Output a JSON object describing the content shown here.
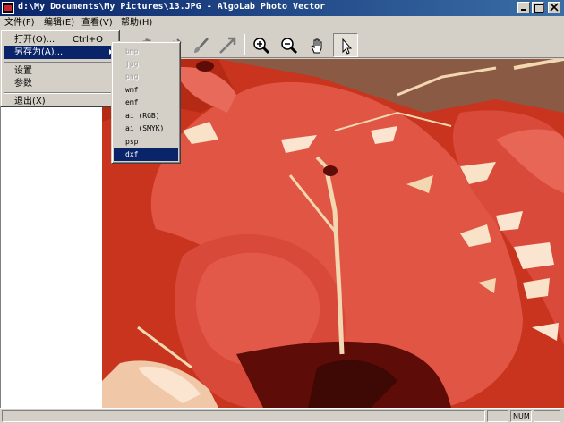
{
  "window": {
    "title": "d:\\My Documents\\My Pictures\\13.JPG - AlgoLab Photo Vector",
    "controls": [
      "minimize",
      "maximize",
      "close"
    ]
  },
  "menubar": [
    "文件(F)",
    "编辑(E)",
    "查看(V)",
    "帮助(H)"
  ],
  "toolbar": {
    "icons": [
      "hand-tool-icon",
      "fill-tool-icon",
      "brush-tool-icon",
      "line-tool-icon",
      "zoom-in-icon",
      "zoom-out-icon",
      "pan-hand-icon",
      "pointer-icon"
    ],
    "active": "pointer-icon"
  },
  "file_menu": {
    "open_label": "打开(O)...",
    "open_shortcut": "Ctrl+O",
    "save_as_label": "另存为(A)...",
    "settings_label": "设置",
    "params_label": "参数",
    "exit_label": "退出(X)"
  },
  "save_as_submenu": [
    {
      "label": "bmp",
      "enabled": false
    },
    {
      "label": "jpg",
      "enabled": false
    },
    {
      "label": "png",
      "enabled": false
    },
    {
      "label": "wmf",
      "enabled": true
    },
    {
      "label": "emf",
      "enabled": true
    },
    {
      "label": "ai (RGB)",
      "enabled": true
    },
    {
      "label": "ai (SMYK)",
      "enabled": true
    },
    {
      "label": "psp",
      "enabled": true
    },
    {
      "label": "dxf",
      "enabled": true,
      "highlighted": true
    }
  ],
  "statusbar": {
    "num_indicator": "NUM"
  },
  "colors": {
    "title_bar_start": "#0a246a",
    "title_bar_end": "#3a6ea5",
    "highlight": "#0a246a",
    "window_face": "#d4d0c8"
  }
}
